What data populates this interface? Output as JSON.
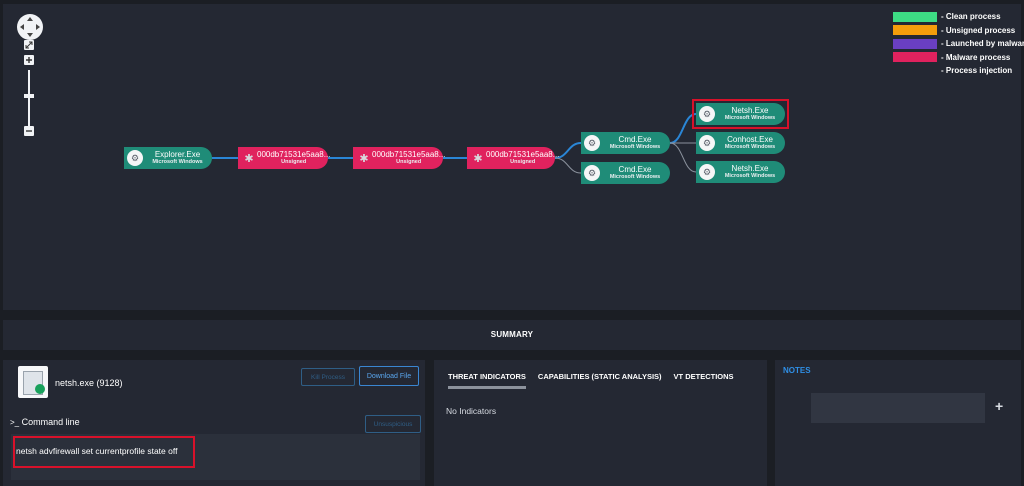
{
  "legend": [
    {
      "label": "- Clean process",
      "color": "#3ddc84"
    },
    {
      "label": "- Unsigned process",
      "color": "#f59e0b"
    },
    {
      "label": "- Launched by malware",
      "color": "#6a3fc2"
    },
    {
      "label": "- Malware process",
      "color": "#e0225e"
    },
    {
      "label": "- Process injection",
      "color": "#242833"
    }
  ],
  "nodes": {
    "explorer": {
      "name": "Explorer.Exe",
      "sub": "Microsoft Windows",
      "icon": "gear-icon"
    },
    "mal1": {
      "name": "000db71531e5aa8...",
      "sub": "Unsigned",
      "icon": "bug-icon"
    },
    "mal2": {
      "name": "000db71531e5aa8...",
      "sub": "Unsigned",
      "icon": "bug-icon"
    },
    "mal3": {
      "name": "000db71531e5aa8...",
      "sub": "Unsigned",
      "icon": "bug-icon"
    },
    "cmd1": {
      "name": "Cmd.Exe",
      "sub": "Microsoft Windows",
      "icon": "gear-icon"
    },
    "cmd2": {
      "name": "Cmd.Exe",
      "sub": "Microsoft Windows",
      "icon": "gear-icon"
    },
    "netsh1": {
      "name": "Netsh.Exe",
      "sub": "Microsoft Windows",
      "icon": "gear-icon"
    },
    "conhost": {
      "name": "Conhost.Exe",
      "sub": "Microsoft Windows",
      "icon": "gear-icon"
    },
    "netsh2": {
      "name": "Netsh.Exe",
      "sub": "Microsoft Windows",
      "icon": "gear-icon"
    }
  },
  "summary": {
    "title": "SUMMARY"
  },
  "process": {
    "name": "netsh.exe (9128)",
    "kill_label": "Kill Process",
    "download_label": "Download File",
    "command_line_label": "Command line",
    "unsuspicious_label": "Unsuspicious",
    "command": "netsh advfirewall set currentprofile state off"
  },
  "threat": {
    "tabs": [
      "THREAT INDICATORS",
      "CAPABILITIES (STATIC ANALYSIS)",
      "VT DETECTIONS"
    ],
    "empty_text": "No Indicators"
  },
  "notes": {
    "title": "NOTES",
    "add_symbol": "+"
  }
}
